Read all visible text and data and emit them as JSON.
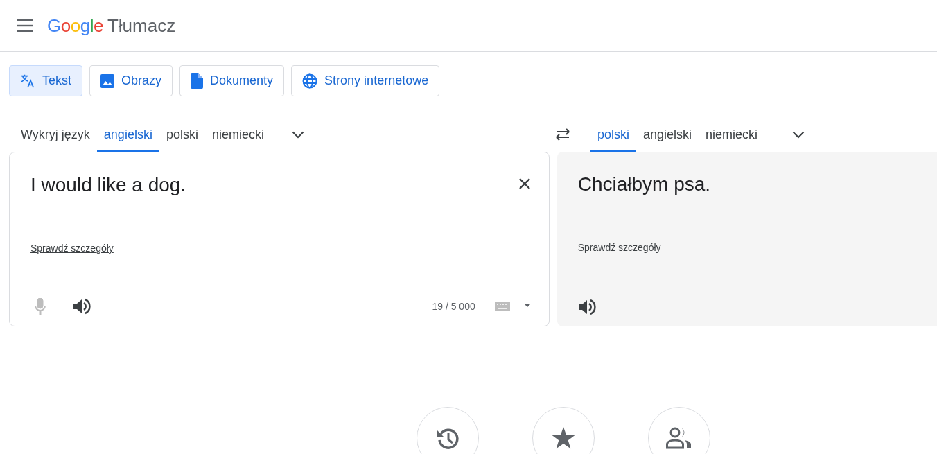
{
  "header": {
    "logo": "Google",
    "product": "Tłumacz"
  },
  "modes": [
    {
      "label": "Tekst",
      "kind": "text",
      "selected": true
    },
    {
      "label": "Obrazy",
      "kind": "image",
      "selected": false
    },
    {
      "label": "Dokumenty",
      "kind": "document",
      "selected": false
    },
    {
      "label": "Strony internetowe",
      "kind": "web",
      "selected": false
    }
  ],
  "source_languages": [
    {
      "label": "Wykryj język",
      "selected": false
    },
    {
      "label": "angielski",
      "selected": true
    },
    {
      "label": "polski",
      "selected": false
    },
    {
      "label": "niemiecki",
      "selected": false
    }
  ],
  "target_languages": [
    {
      "label": "polski",
      "selected": true
    },
    {
      "label": "angielski",
      "selected": false
    },
    {
      "label": "niemiecki",
      "selected": false
    }
  ],
  "source": {
    "value": "I would like a dog.",
    "details_link": "Sprawdź szczegóły",
    "char_count": "19 / 5 000",
    "mic_disabled": true
  },
  "target": {
    "text": "Chciałbym psa.",
    "details_link": "Sprawdź szczegóły"
  }
}
